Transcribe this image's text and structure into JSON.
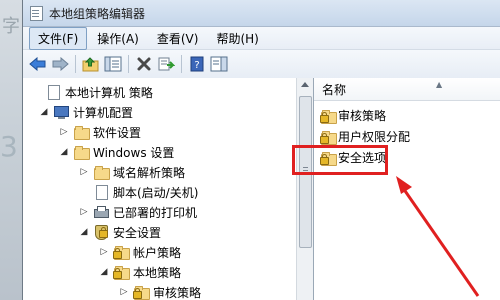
{
  "window": {
    "title": "本地组策略编辑器"
  },
  "menu": [
    "文件(F)",
    "操作(A)",
    "查看(V)",
    "帮助(H)"
  ],
  "tree": [
    {
      "label": "本地计算机 策略",
      "level": 0,
      "expander": "",
      "icon": "doc-icon"
    },
    {
      "label": "计算机配置",
      "level": 1,
      "expander": "◢",
      "icon": "computer-icon"
    },
    {
      "label": "软件设置",
      "level": 2,
      "expander": "▷",
      "icon": "folder-icon"
    },
    {
      "label": "Windows 设置",
      "level": 2,
      "expander": "◢",
      "icon": "folder-icon"
    },
    {
      "label": "域名解析策略",
      "level": 3,
      "expander": "▷",
      "icon": "folder-icon"
    },
    {
      "label": "脚本(启动/关机)",
      "level": 3,
      "expander": "",
      "icon": "doc-icon"
    },
    {
      "label": "已部署的打印机",
      "level": 3,
      "expander": "▷",
      "icon": "printer-icon"
    },
    {
      "label": "安全设置",
      "level": 3,
      "expander": "◢",
      "icon": "shield-icon"
    },
    {
      "label": "帐户策略",
      "level": 4,
      "expander": "▷",
      "icon": "folder-lock-icon"
    },
    {
      "label": "本地策略",
      "level": 4,
      "expander": "◢",
      "icon": "folder-lock-icon"
    },
    {
      "label": "审核策略",
      "level": 5,
      "expander": "▷",
      "icon": "folder-lock-icon"
    }
  ],
  "list": {
    "column_name": "名称",
    "items": [
      "审核策略",
      "用户权限分配",
      "安全选项"
    ]
  },
  "annotation": {
    "highlight_color": "#e02020"
  }
}
